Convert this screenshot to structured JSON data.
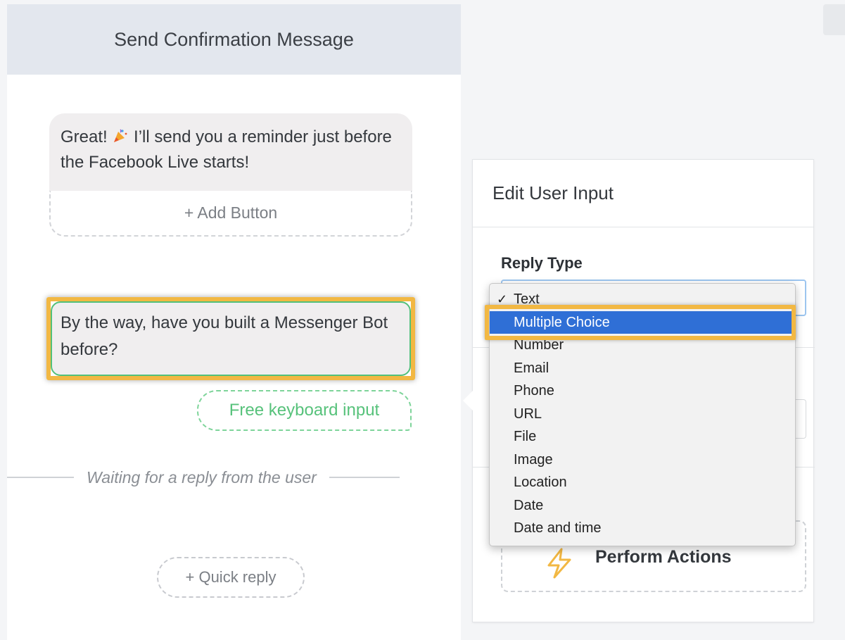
{
  "left_panel": {
    "header": "Send Confirmation Message",
    "message1": {
      "text_before_icon": "Great!",
      "icon": "party-popper-icon",
      "text_after_icon": "I’ll send you a reminder just before the Facebook Live starts!",
      "add_button_label": "+ Add Button"
    },
    "message2": {
      "text": "By the way, have you built a Messenger Bot before?"
    },
    "free_input_label": "Free keyboard input",
    "divider_label": "Waiting for a reply from the user",
    "quick_reply_label": "+ Quick reply"
  },
  "edit_panel": {
    "title": "Edit User Input",
    "reply_type_label": "Reply Type",
    "perform_actions_label": "Perform Actions",
    "perform_icon": "lightning-bolt-icon"
  },
  "dropdown": {
    "checked_value": "Text",
    "highlighted_value": "Multiple Choice",
    "options": [
      "Text",
      "Multiple Choice",
      "Number",
      "Email",
      "Phone",
      "URL",
      "File",
      "Image",
      "Location",
      "Date",
      "Date and time"
    ]
  },
  "colors": {
    "highlight": "#f2b843",
    "accent_green": "#57c27b",
    "selected_blue": "#2f6fd6",
    "header_bg": "#e3e7ee"
  }
}
